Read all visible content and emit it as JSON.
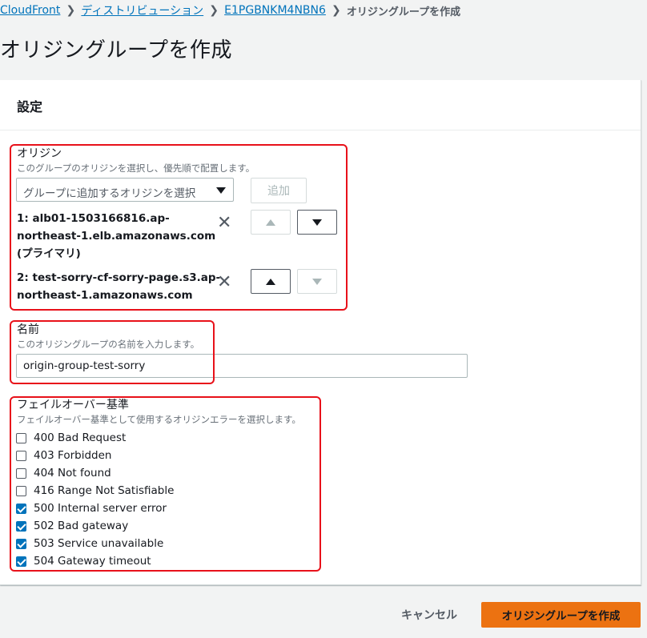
{
  "breadcrumb": {
    "items": [
      "CloudFront",
      "ディストリビューション",
      "E1PGBNKM4NBN6"
    ],
    "current": "オリジングループを作成"
  },
  "page_title": "オリジングループを作成",
  "settings": {
    "header": "設定",
    "origins": {
      "label": "オリジン",
      "description": "このグループのオリジンを選択し、優先順で配置します。",
      "select_placeholder": "グループに追加するオリジンを選択",
      "add_label": "追加",
      "list": [
        {
          "line1": "1: alb01-1503166816.ap-",
          "line2": "northeast-1.elb.amazonaws.com",
          "line3": "(プライマリ)",
          "up_enabled": false,
          "down_enabled": true
        },
        {
          "line1": "2: test-sorry-cf-sorry-page.s3.ap-",
          "line2": "northeast-1.amazonaws.com",
          "line3": "",
          "up_enabled": true,
          "down_enabled": false
        }
      ]
    },
    "name": {
      "label": "名前",
      "description": "このオリジングループの名前を入力します。",
      "value": "origin-group-test-sorry"
    },
    "failover": {
      "label": "フェイルオーバー基準",
      "description": "フェイルオーバー基準として使用するオリジンエラーを選択します。",
      "options": [
        {
          "label": "400 Bad Request",
          "checked": false
        },
        {
          "label": "403 Forbidden",
          "checked": false
        },
        {
          "label": "404 Not found",
          "checked": false
        },
        {
          "label": "416 Range Not Satisfiable",
          "checked": false
        },
        {
          "label": "500 Internal server error",
          "checked": true
        },
        {
          "label": "502 Bad gateway",
          "checked": true
        },
        {
          "label": "503 Service unavailable",
          "checked": true
        },
        {
          "label": "504 Gateway timeout",
          "checked": true
        }
      ]
    }
  },
  "footer": {
    "cancel_label": "キャンセル",
    "create_label": "オリジングループを作成"
  },
  "colors": {
    "link": "#0073bb",
    "primary_button": "#ec7211",
    "checkbox_checked": "#0073bb",
    "annotation_box": "#e8111a"
  }
}
